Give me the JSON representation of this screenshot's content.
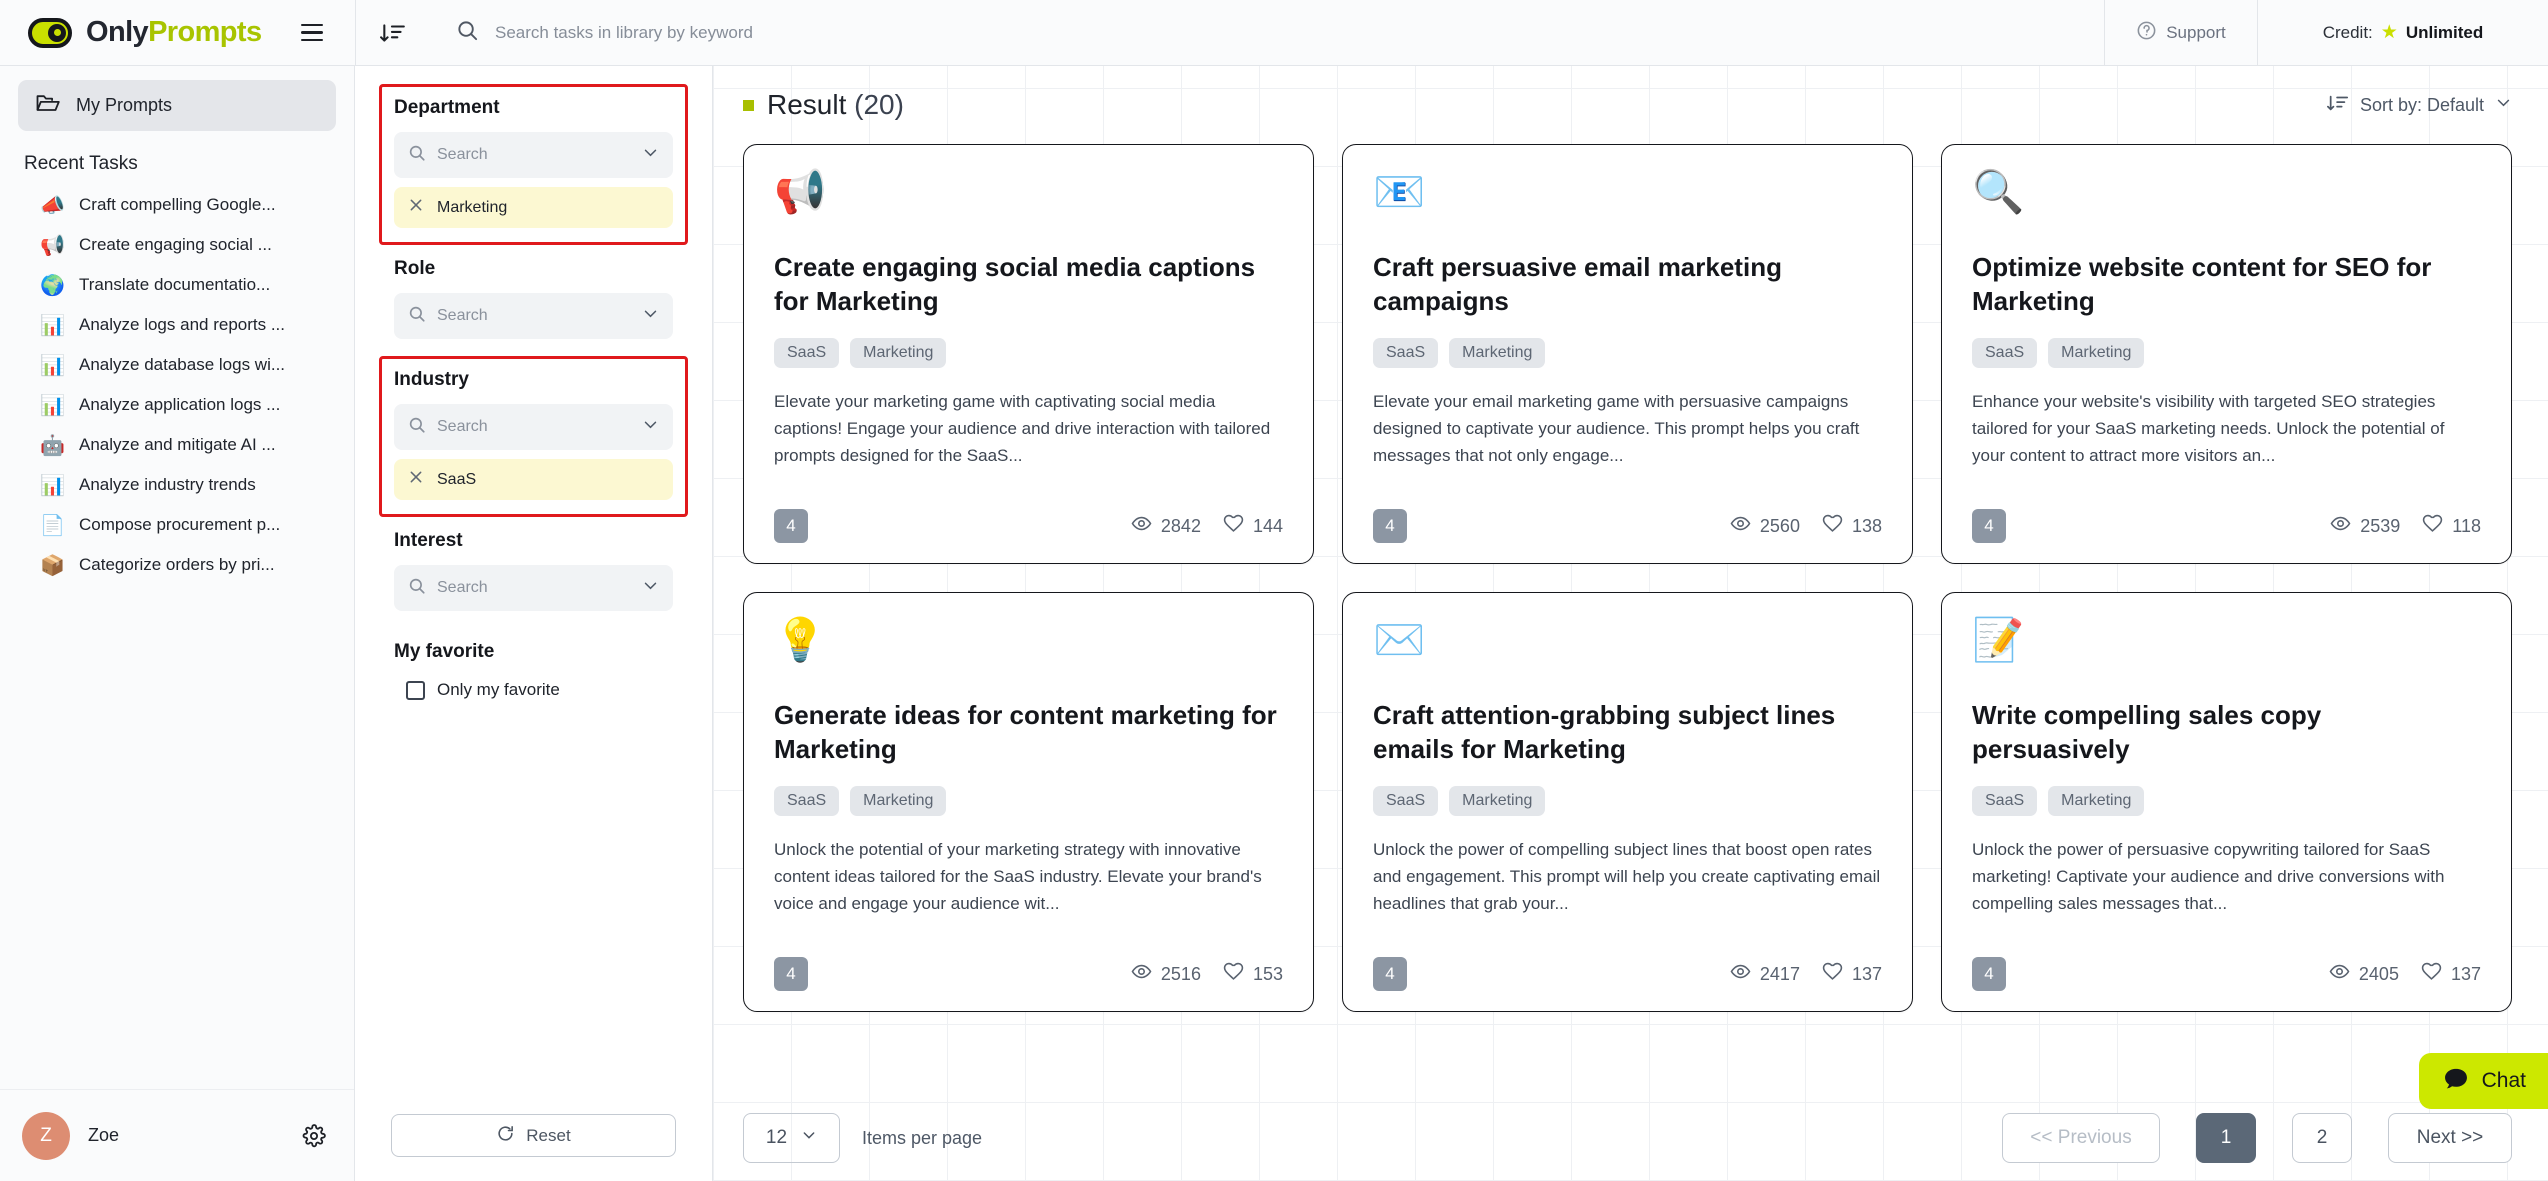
{
  "brand": {
    "name_part1": "Only",
    "name_part2": "Prompts"
  },
  "topbar": {
    "menu_icon": "hamburger-icon",
    "sort_icon": "sort-descending-icon",
    "search_placeholder": "Search tasks in library by keyword",
    "search_value": "",
    "support_label": "Support",
    "credit_label": "Credit:",
    "credit_value": "Unlimited",
    "star_glyph": "★"
  },
  "sidebar": {
    "my_prompts_label": "My Prompts",
    "recent_title": "Recent Tasks",
    "tasks": [
      {
        "emoji": "📣",
        "label": "Craft compelling Google..."
      },
      {
        "emoji": "📢",
        "label": "Create engaging social ..."
      },
      {
        "emoji": "🌍",
        "label": "Translate documentatio..."
      },
      {
        "emoji": "📊",
        "label": "Analyze logs and reports ..."
      },
      {
        "emoji": "📊",
        "label": "Analyze database logs wi..."
      },
      {
        "emoji": "📊",
        "label": "Analyze application logs ..."
      },
      {
        "emoji": "🤖",
        "label": "Analyze and mitigate AI ..."
      },
      {
        "emoji": "📊",
        "label": "Analyze industry trends"
      },
      {
        "emoji": "📄",
        "label": "Compose procurement p..."
      },
      {
        "emoji": "📦",
        "label": "Categorize orders by pri..."
      }
    ],
    "user": {
      "initial": "Z",
      "name": "Zoe"
    }
  },
  "filters": {
    "groups": [
      {
        "title": "Department",
        "search_placeholder": "Search",
        "highlighted": true,
        "chips": [
          {
            "label": "Marketing"
          }
        ]
      },
      {
        "title": "Role",
        "search_placeholder": "Search",
        "highlighted": false,
        "chips": []
      },
      {
        "title": "Industry",
        "search_placeholder": "Search",
        "highlighted": true,
        "chips": [
          {
            "label": "SaaS"
          }
        ]
      },
      {
        "title": "Interest",
        "search_placeholder": "Search",
        "highlighted": false,
        "chips": []
      }
    ],
    "favorite_title": "My favorite",
    "favorite_label": "Only my favorite",
    "favorite_checked": false,
    "reset_label": "Reset"
  },
  "results": {
    "title": "Result",
    "count": "(20)",
    "sort_label": "Sort by: Default",
    "cards": [
      {
        "emoji": "📢",
        "icon_name": "megaphone-icon",
        "title": "Create engaging social media captions for Marketing",
        "tags": [
          "SaaS",
          "Marketing"
        ],
        "description": "Elevate your marketing game with captivating social media captions! Engage your audience and drive interaction with tailored prompts designed for the SaaS...",
        "steps": "4",
        "views": "2842",
        "likes": "144"
      },
      {
        "emoji": "📧",
        "icon_name": "email-icon",
        "title": "Craft persuasive email marketing campaigns",
        "tags": [
          "SaaS",
          "Marketing"
        ],
        "description": "Elevate your email marketing game with persuasive campaigns designed to captivate your audience. This prompt helps you craft messages that not only engage...",
        "steps": "4",
        "views": "2560",
        "likes": "138"
      },
      {
        "emoji": "🔍",
        "icon_name": "magnifier-icon",
        "title": "Optimize website content for SEO for Marketing",
        "tags": [
          "SaaS",
          "Marketing"
        ],
        "description": "Enhance your website's visibility with targeted SEO strategies tailored for your SaaS marketing needs. Unlock the potential of your content to attract more visitors an...",
        "steps": "4",
        "views": "2539",
        "likes": "118"
      },
      {
        "emoji": "💡",
        "icon_name": "lightbulb-icon",
        "title": "Generate ideas for content marketing for Marketing",
        "tags": [
          "SaaS",
          "Marketing"
        ],
        "description": "Unlock the potential of your marketing strategy with innovative content ideas tailored for the SaaS industry. Elevate your brand's voice and engage your audience wit...",
        "steps": "4",
        "views": "2516",
        "likes": "153"
      },
      {
        "emoji": "✉️",
        "icon_name": "envelope-icon",
        "title": "Craft attention-grabbing subject lines emails for Marketing",
        "tags": [
          "SaaS",
          "Marketing"
        ],
        "description": "Unlock the power of compelling subject lines that boost open rates and engagement. This prompt will help you create captivating email headlines that grab your...",
        "steps": "4",
        "views": "2417",
        "likes": "137"
      },
      {
        "emoji": "📝",
        "icon_name": "memo-icon",
        "title": "Write compelling sales copy persuasively",
        "tags": [
          "SaaS",
          "Marketing"
        ],
        "description": "Unlock the power of persuasive copywriting tailored for SaaS marketing! Captivate your audience and drive conversions with compelling sales messages that...",
        "steps": "4",
        "views": "2405",
        "likes": "137"
      }
    ]
  },
  "pagination": {
    "per_page_value": "12",
    "per_page_label": "Items per page",
    "previous_label": "<< Previous",
    "next_label": "Next >>",
    "pages": [
      "1",
      "2"
    ],
    "active_page": "1"
  },
  "chat": {
    "label": "Chat"
  },
  "colors": {
    "brand_green": "#a8c400",
    "chat_green": "#cce800",
    "highlight_red": "#e0191c",
    "chip_yellow": "#fcf8d2",
    "avatar": "#dd8d72",
    "active_page": "#5b6877"
  }
}
